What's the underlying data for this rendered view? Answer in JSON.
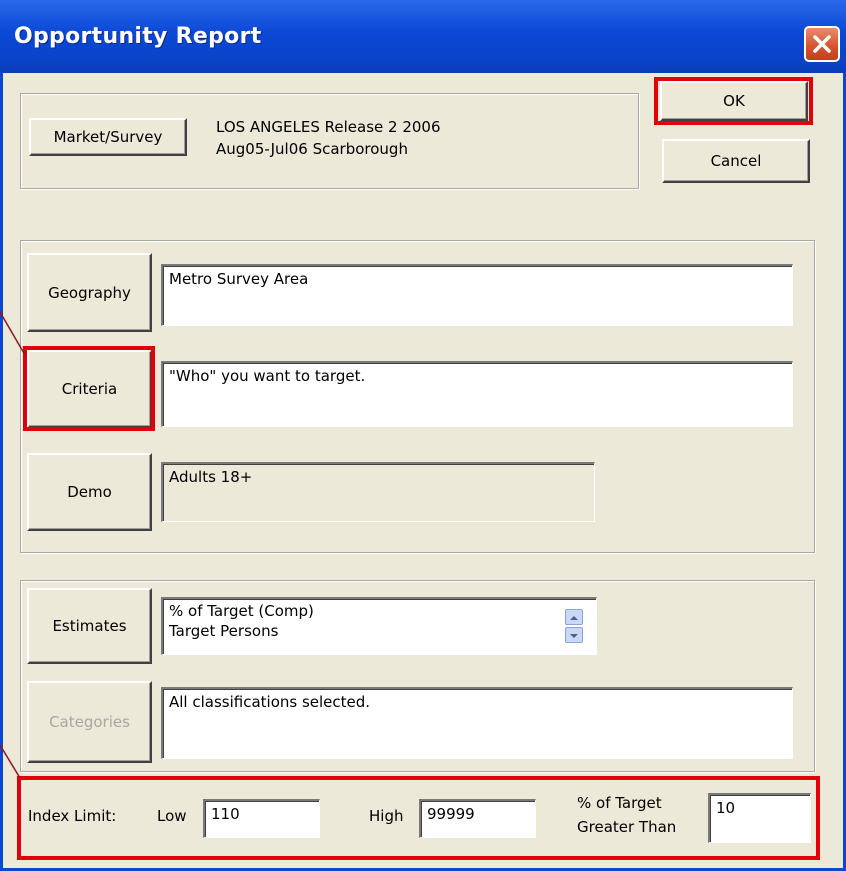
{
  "window": {
    "title": "Opportunity Report"
  },
  "market": {
    "button_label": "Market/Survey",
    "line1": "LOS ANGELES Release 2 2006",
    "line2": "Aug05-Jul06 Scarborough"
  },
  "actions": {
    "ok_label": "OK",
    "cancel_label": "Cancel"
  },
  "geography": {
    "button_label": "Geography",
    "value": "Metro Survey Area"
  },
  "criteria": {
    "button_label": "Criteria",
    "value": "\"Who\" you want to target."
  },
  "demo": {
    "button_label": "Demo",
    "value": "Adults 18+"
  },
  "estimates": {
    "button_label": "Estimates",
    "items": [
      "% of Target (Comp)",
      "Target Persons"
    ]
  },
  "categories": {
    "button_label": "Categories",
    "value": "All classifications selected."
  },
  "index_limit": {
    "label": "Index Limit:",
    "low_label": "Low",
    "low_value": "110",
    "high_label": "High",
    "high_value": "99999",
    "pct_label_line1": "% of Target",
    "pct_label_line2": "Greater Than",
    "pct_value": "10"
  },
  "colors": {
    "highlight": "#e4000b",
    "titlebar": "#0b48d6",
    "dialog_bg": "#ece9d8"
  }
}
